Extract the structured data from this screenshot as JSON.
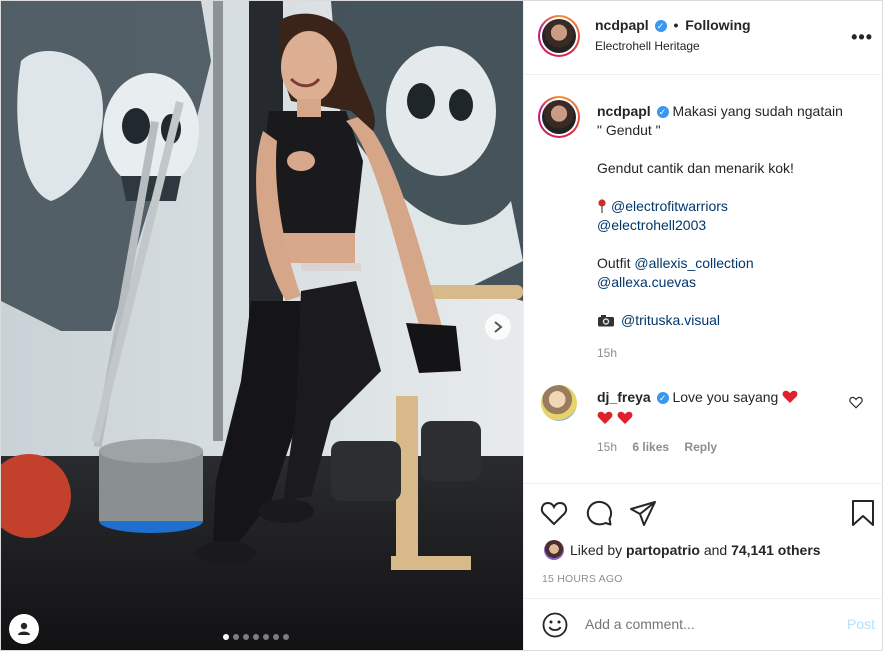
{
  "header": {
    "username": "ncdpapl",
    "separator": "•",
    "follow_status": "Following",
    "location": "Electrohell Heritage"
  },
  "caption": {
    "username": "ncdpapl",
    "line1": "Makasi yang sudah ngatain",
    "line2": "\" Gendut \"",
    "line3": "Gendut cantik dan menarik kok!",
    "mention1": "@electrofitwarriors",
    "mention2": "@electrohell2003",
    "outfit_label": "Outfit",
    "mention3": "@allexis_collection",
    "mention4": "@allexa.cuevas",
    "mention5": "@trituska.visual",
    "time": "15h"
  },
  "comment": {
    "username": "dj_freya",
    "text": "Love you sayang",
    "time": "15h",
    "likes": "6 likes",
    "reply": "Reply"
  },
  "likes": {
    "prefix": "Liked by",
    "user": "partopatrio",
    "middle": "and",
    "count": "74,141 others"
  },
  "timestamp": "15 HOURS AGO",
  "add_comment": {
    "placeholder": "Add a comment...",
    "post_label": "Post"
  },
  "carousel": {
    "total": 7,
    "active_index": 0
  },
  "icons": {
    "verified": "verified-badge-icon",
    "more": "more-options-icon",
    "heart": "heart-icon",
    "comment": "comment-icon",
    "share": "share-icon",
    "save": "bookmark-icon",
    "emoji": "emoji-icon",
    "next": "chevron-right-icon",
    "tag": "user-tag-icon"
  },
  "colors": {
    "link": "#00376b",
    "verified": "#3897f0",
    "heart_red": "#ed4956",
    "muted": "#8e8e8e",
    "post_disabled": "#b2dffc"
  }
}
